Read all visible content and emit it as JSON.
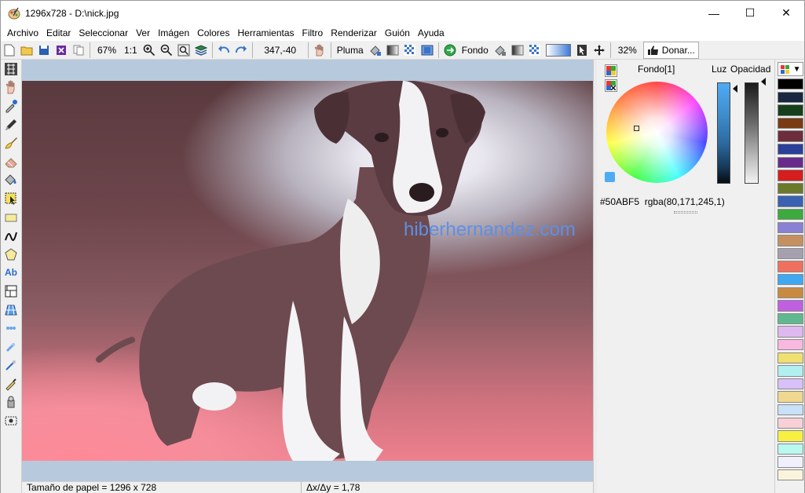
{
  "window": {
    "title": "1296x728 - D:\\nick.jpg",
    "minimize": "—",
    "maximize": "☐",
    "close": "✕"
  },
  "menu": [
    "Archivo",
    "Editar",
    "Seleccionar",
    "Ver",
    "Imágen",
    "Colores",
    "Herramientas",
    "Filtro",
    "Renderizar",
    "Guión",
    "Ayuda"
  ],
  "toolbar": {
    "zoom": "67%",
    "one_to_one": "1:1",
    "coords": "347,-40",
    "pen_label": "Pluma",
    "background_label": "Fondo",
    "opacity_percent": "32%",
    "donate_label": "Donar..."
  },
  "canvas": {
    "watermark": "hiberhernandez.com"
  },
  "status": {
    "paper_size": "Tamaño de papel = 1296 x 728",
    "ratio": "Δx/Δy = 1,78"
  },
  "color_panel": {
    "title": "Fondo[1]",
    "light_label": "Luz",
    "opacity_label": "Opacidad",
    "hex": "#50ABF5",
    "rgba": "rgba(80,171,245,1)",
    "current_color": "#50abf5"
  },
  "palette": {
    "colors": [
      "#000000",
      "#1a2740",
      "#17401a",
      "#7a3a14",
      "#6e2d3d",
      "#2b3e9a",
      "#6a2a8c",
      "#d61e1e",
      "#6a7a2a",
      "#3a62b0",
      "#3caa3c",
      "#8a80d6",
      "#c49060",
      "#a6a0ae",
      "#f07060",
      "#40a8f0",
      "#c88a40",
      "#c060e0",
      "#60b890",
      "#e0b8f0",
      "#f8b8e0",
      "#f0e070",
      "#b0f0f0",
      "#d8c0f8",
      "#f0d890",
      "#c8e0f8",
      "#f8d0d8",
      "#f8f040",
      "#b8f8f0",
      "#f0f0fc",
      "#faf4dc"
    ]
  }
}
